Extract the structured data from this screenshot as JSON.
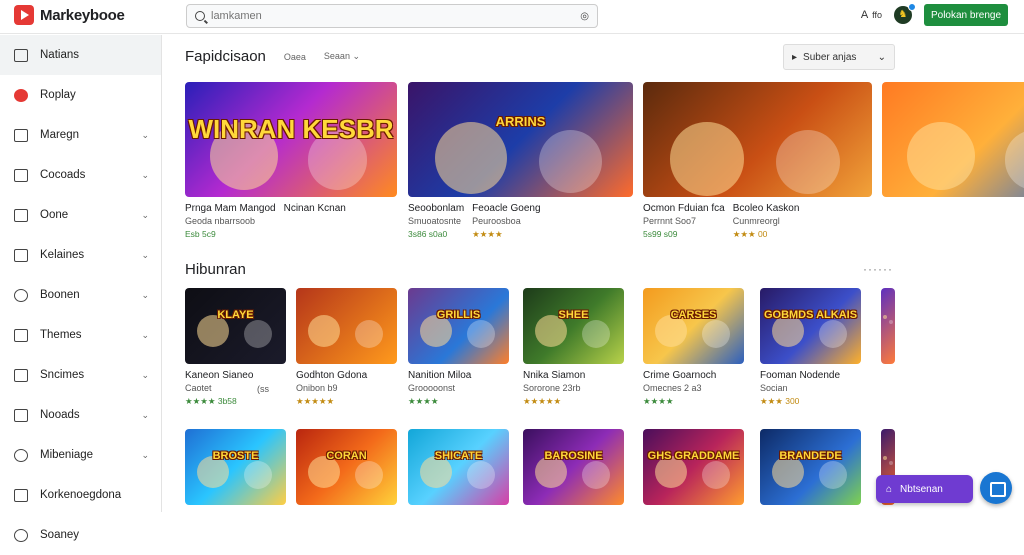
{
  "app": {
    "name": "Markeybooe"
  },
  "search": {
    "placeholder": "lamkamen"
  },
  "header": {
    "lang_label": "A",
    "lang_arrow": "ffo",
    "install_label": "Polokan brenge"
  },
  "sidebar": {
    "items": [
      {
        "label": "Natians",
        "icon": "home-icon",
        "chev": false
      },
      {
        "label": "Roplay",
        "icon": "record-icon",
        "chev": false
      },
      {
        "label": "Maregn",
        "icon": "folder-icon",
        "chev": true
      },
      {
        "label": "Cocoads",
        "icon": "bag-icon",
        "chev": true
      },
      {
        "label": "Oone",
        "icon": "box-icon",
        "chev": true
      },
      {
        "label": "Kelaines",
        "icon": "check-box-icon",
        "chev": true
      },
      {
        "label": "Boonen",
        "icon": "person-icon",
        "chev": true
      },
      {
        "label": "Themes",
        "icon": "list-icon",
        "chev": true
      },
      {
        "label": "Sncimes",
        "icon": "book-icon",
        "chev": true
      },
      {
        "label": "Nooads",
        "icon": "grid-icon",
        "chev": true
      },
      {
        "label": "Mibeniage",
        "icon": "globe-icon",
        "chev": true
      },
      {
        "label": "Korkenoegdona",
        "icon": "edit-icon",
        "chev": false
      },
      {
        "label": "Soaney",
        "icon": "circle-icon",
        "chev": false
      }
    ]
  },
  "section1": {
    "title": "Fapidcisaon",
    "filter1": "Oaea",
    "filter2": "Seaan",
    "sort_label": "Suber anjas"
  },
  "featured": [
    {
      "art_title": "WINRAN KESBR",
      "t1": "Prnga Mam Mangod",
      "t2": "Geoda nbarrsoob",
      "t3": "Esb 5c9"
    },
    {
      "art_title": "",
      "t1": "Ncinan Kcnan",
      "t2": "",
      "t3": ""
    },
    {
      "art_title": "ARRINS",
      "t1": "Seoobonlam",
      "t2": "Smuoatosnte",
      "t3": "3s86 s0a0"
    },
    {
      "art_title": "",
      "t1": "Feoacle Goeng",
      "t2": "Peuroosboa",
      "t3": "★★★★"
    },
    {
      "art_title": "",
      "t1": "Ocmon Fduian fca",
      "t2": "Perrnnt Soo7",
      "t3": "5s99 s09"
    },
    {
      "art_title": "",
      "t1": "Bcoleo Kaskon",
      "t2": "Cunmreorgl",
      "t3": "★★★ 00"
    }
  ],
  "section2": {
    "title": "Hibunran",
    "more": "······"
  },
  "grid_row1": [
    {
      "art_title": "KLAYE",
      "t1": "Kaneon Sianeo",
      "t2": "Caotet",
      "t3": "★★★★ 3b58",
      "extra": "(ss"
    },
    {
      "art_title": "",
      "t1": "Godhton Gdona",
      "t2": "Onibon b9",
      "t3": "★★★★★"
    },
    {
      "art_title": "GRILLIS",
      "t1": "Nanition Miloa",
      "t2": "Grooooonst",
      "t3": "★★★★"
    },
    {
      "art_title": "SHEE",
      "t1": "Nnika Siamon",
      "t2": "Sororone 23rb",
      "t3": "★★★★★"
    },
    {
      "art_title": "CARSES",
      "t1": "Crime Goarnoch",
      "t2": "Omecnes 2 a3",
      "t3": "★★★★"
    },
    {
      "art_title": "GOBMDS ALKAIS",
      "t1": "Fooman Nodende",
      "t2": "Socian",
      "t3": "★★★ 300"
    }
  ],
  "grid_row2": [
    {
      "art_title": "BROSTE"
    },
    {
      "art_title": "CORAN"
    },
    {
      "art_title": "SHICATE"
    },
    {
      "art_title": "BAROSINE"
    },
    {
      "art_title": "GHS GRADDAME"
    },
    {
      "art_title": "BRANDEDE"
    }
  ],
  "fab": {
    "promo_label": "Nbtsenan"
  }
}
